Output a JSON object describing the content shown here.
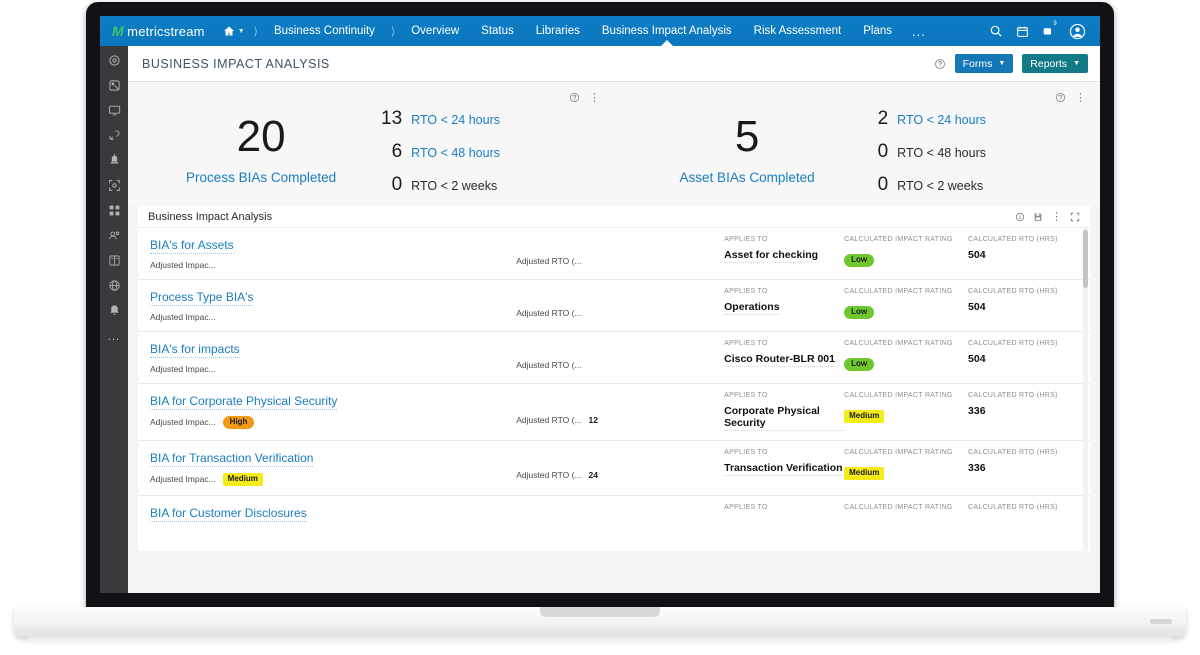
{
  "topnav": {
    "logo_mark": "M",
    "logo_text": "metricstream",
    "home_icon": "home-icon",
    "breadcrumb": [
      {
        "label": "Business Continuity"
      }
    ],
    "items": [
      {
        "label": "Overview",
        "active": false
      },
      {
        "label": "Status",
        "active": false
      },
      {
        "label": "Libraries",
        "active": false
      },
      {
        "label": "Business Impact Analysis",
        "active": true
      },
      {
        "label": "Risk Assessment",
        "active": false
      },
      {
        "label": "Plans",
        "active": false
      }
    ],
    "overflow_label": "...",
    "right_icons": [
      {
        "name": "search-icon"
      },
      {
        "name": "calendar-icon"
      },
      {
        "name": "notifications-icon",
        "badge": "9"
      },
      {
        "name": "user-avatar-icon"
      }
    ]
  },
  "rail": {
    "icons": [
      "settings-gear-icon",
      "tag-icon",
      "monitor-icon",
      "link-broken-icon",
      "alert-beacon-icon",
      "expand-scan-icon",
      "grid-apps-icon",
      "users-group-icon",
      "book-library-icon",
      "globe-icon",
      "bell-icon"
    ],
    "more_label": "..."
  },
  "pagehead": {
    "title": "BUSINESS IMPACT ANALYSIS",
    "help_icon": "help-circle-icon",
    "forms_button": "Forms",
    "reports_button": "Reports",
    "caret": "▼"
  },
  "kpis": [
    {
      "name": "process-bias",
      "value": "20",
      "label": "Process BIAs Completed",
      "breakdown": [
        {
          "count": "13",
          "text": "RTO < 24 hours",
          "link": true
        },
        {
          "count": "6",
          "text": "RTO < 48 hours",
          "link": true
        },
        {
          "count": "0",
          "text": "RTO < 2 weeks",
          "link": false
        }
      ]
    },
    {
      "name": "asset-bias",
      "value": "5",
      "label": "Asset BIAs Completed",
      "breakdown": [
        {
          "count": "2",
          "text": "RTO < 24 hours",
          "link": true
        },
        {
          "count": "0",
          "text": "RTO < 48 hours",
          "link": false
        },
        {
          "count": "0",
          "text": "RTO < 2 weeks",
          "link": false
        }
      ]
    }
  ],
  "table": {
    "title": "Business Impact Analysis",
    "tools": [
      "info-circle-icon",
      "export-icon",
      "kebab-menu-icon",
      "fullscreen-icon"
    ],
    "column_headers": {
      "applies_to": "APPLIES TO",
      "impact_rating": "CALCULATED IMPACT RATING",
      "rto": "CALCULATED RTO (HRS)"
    },
    "inline_labels": {
      "adjusted_impact": "Adjusted Impac...",
      "adjusted_rto": "Adjusted RTO (..."
    },
    "rows": [
      {
        "name": "BIA's for Assets",
        "adjusted_impact_badge": "",
        "adjusted_rto_value": "",
        "applies_to": "Asset for checking",
        "impact_rating": "Low",
        "impact_rating_class": "low",
        "rto": "504"
      },
      {
        "name": "Process Type BIA's",
        "adjusted_impact_badge": "",
        "adjusted_rto_value": "",
        "applies_to": "Operations",
        "impact_rating": "Low",
        "impact_rating_class": "low",
        "rto": "504"
      },
      {
        "name": "BIA's for impacts",
        "adjusted_impact_badge": "",
        "adjusted_rto_value": "",
        "applies_to": "Cisco Router-BLR 001",
        "impact_rating": "Low",
        "impact_rating_class": "low",
        "rto": "504"
      },
      {
        "name": "BIA for Corporate Physical Security",
        "adjusted_impact_badge": "High",
        "adjusted_impact_class": "high",
        "adjusted_rto_value": "12",
        "applies_to": "Corporate Physical Security",
        "impact_rating": "Medium",
        "impact_rating_class": "medium",
        "rto": "336"
      },
      {
        "name": "BIA for Transaction Verification",
        "adjusted_impact_badge": "Medium",
        "adjusted_impact_class": "medium",
        "adjusted_rto_value": "24",
        "applies_to": "Transaction Verification",
        "impact_rating": "Medium",
        "impact_rating_class": "medium",
        "rto": "336"
      },
      {
        "name": "BIA for Customer Disclosures",
        "adjusted_impact_badge": "",
        "adjusted_rto_value": "",
        "applies_to": "",
        "impact_rating": "",
        "impact_rating_class": "",
        "rto": ""
      }
    ]
  },
  "colors": {
    "brand_blue": "#0c77bd",
    "link_blue": "#1a7ec0",
    "logo_green": "#3ec46d",
    "forms_button": "#1577b5",
    "reports_button": "#157a87",
    "pill_low": "#6ec72f",
    "pill_medium": "#f5ea1a",
    "pill_high": "#f09a16",
    "rail_bg": "#3a3a3c"
  }
}
